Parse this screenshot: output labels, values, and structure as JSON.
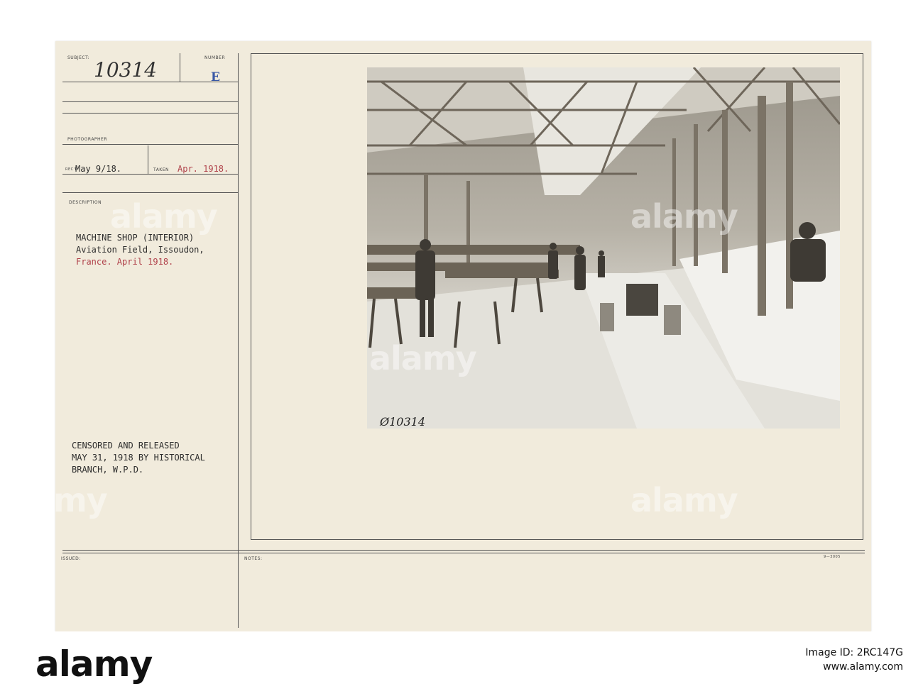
{
  "card": {
    "subject_label": "SUBJECT:",
    "subject_value": "10314",
    "number_label": "NUMBER",
    "number_value": "E",
    "photographer_label": "PHOTOGRAPHER",
    "recd_label": "REC'D",
    "recd_value": "May 9/18.",
    "taken_label": "TAKEN",
    "taken_value": "Apr. 1918.",
    "description_label": "DESCRIPTION",
    "description_line1": "MACHINE SHOP (INTERIOR)",
    "description_line2": "Aviation Field, Issoudon,",
    "description_line3": "France. April 1918.",
    "censor_line1": "CENSORED AND RELEASED",
    "censor_line2": "MAY 31, 1918 BY HISTORICAL",
    "censor_line3": "BRANCH, W.P.D.",
    "issued_label": "ISSUED:",
    "notes_label": "NOTES:",
    "form_number": "9—3005",
    "photo_caption": "Ø10314"
  },
  "watermark": {
    "text": "alamy"
  },
  "footer": {
    "logo": "alamy",
    "image_id_label": "Image ID: 2RC147G",
    "site": "www.alamy.com"
  },
  "colors": {
    "card": "#f1ebdc",
    "red_ink": "#b0414a",
    "blue_stamp": "#3a58a6"
  }
}
